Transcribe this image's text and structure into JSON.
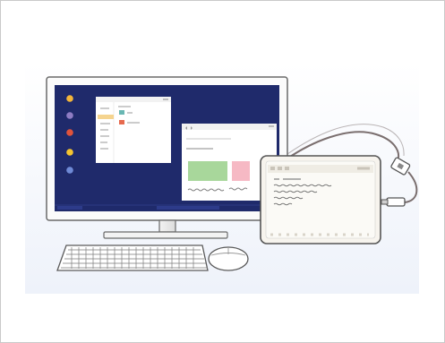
{
  "illustration": {
    "subject": "monitor-connected-to-tablet",
    "background": "#ffffff",
    "desktop_bg": "#1f2a6b",
    "dock_colors": [
      "#f4b63a",
      "#8e7cc3",
      "#e0533b",
      "#f4c430",
      "#6f8ad6"
    ],
    "accent_green": "#a8d79b",
    "accent_pink": "#f6b9c4",
    "highlight_yellow": "#f5d48f",
    "cable": "#7a6e6e"
  }
}
